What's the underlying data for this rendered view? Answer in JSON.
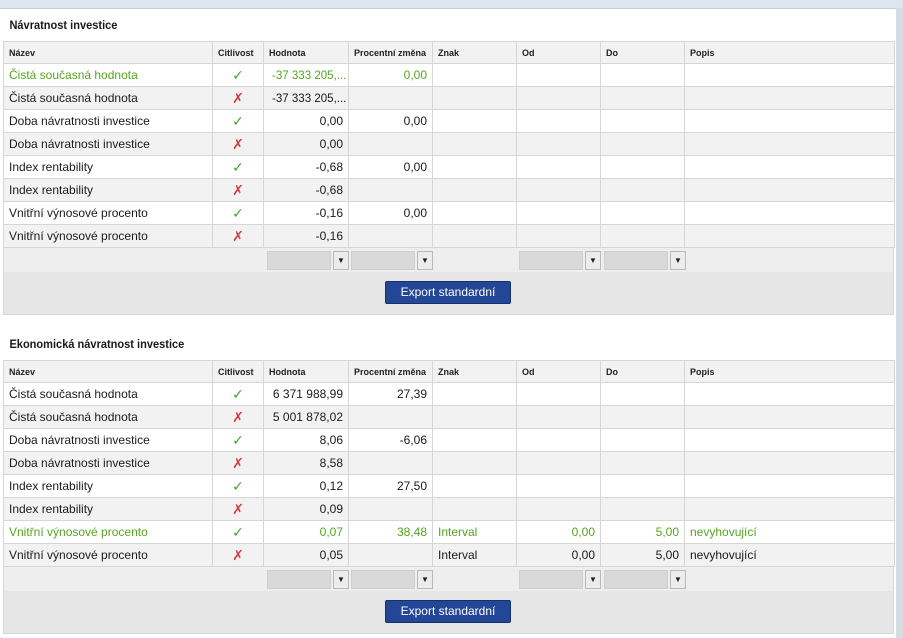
{
  "sections": [
    {
      "title": "Návratnost investice",
      "columns": [
        "Název",
        "Citlivost",
        "Hodnota",
        "Procentní změna",
        "Znak",
        "Od",
        "Do",
        "Popis"
      ],
      "rows": [
        {
          "name": "Čistá současná hodnota",
          "sensitivity": "✓",
          "value": "-37 333 205,...",
          "change": "0,00",
          "sign": "",
          "from": "",
          "to": "",
          "desc": "",
          "highlight": true
        },
        {
          "name": "Čistá současná hodnota",
          "sensitivity": "✗",
          "value": "-37 333 205,...",
          "change": "",
          "sign": "",
          "from": "",
          "to": "",
          "desc": "",
          "highlight": false
        },
        {
          "name": "Doba návratnosti investice",
          "sensitivity": "✓",
          "value": "0,00",
          "change": "0,00",
          "sign": "",
          "from": "",
          "to": "",
          "desc": "",
          "highlight": false
        },
        {
          "name": "Doba návratnosti investice",
          "sensitivity": "✗",
          "value": "0,00",
          "change": "",
          "sign": "",
          "from": "",
          "to": "",
          "desc": "",
          "highlight": false
        },
        {
          "name": "Index rentability",
          "sensitivity": "✓",
          "value": "-0,68",
          "change": "0,00",
          "sign": "",
          "from": "",
          "to": "",
          "desc": "",
          "highlight": false
        },
        {
          "name": "Index rentability",
          "sensitivity": "✗",
          "value": "-0,68",
          "change": "",
          "sign": "",
          "from": "",
          "to": "",
          "desc": "",
          "highlight": false
        },
        {
          "name": "Vnitřní výnosové procento",
          "sensitivity": "✓",
          "value": "-0,16",
          "change": "0,00",
          "sign": "",
          "from": "",
          "to": "",
          "desc": "",
          "highlight": false
        },
        {
          "name": "Vnitřní výnosové procento",
          "sensitivity": "✗",
          "value": "-0,16",
          "change": "",
          "sign": "",
          "from": "",
          "to": "",
          "desc": "",
          "highlight": false
        }
      ],
      "export_label": "Export standardní"
    },
    {
      "title": "Ekonomická návratnost investice",
      "columns": [
        "Název",
        "Citlivost",
        "Hodnota",
        "Procentní změna",
        "Znak",
        "Od",
        "Do",
        "Popis"
      ],
      "rows": [
        {
          "name": "Čistá současná hodnota",
          "sensitivity": "✓",
          "value": "6 371 988,99",
          "change": "27,39",
          "sign": "",
          "from": "",
          "to": "",
          "desc": "",
          "highlight": false
        },
        {
          "name": "Čistá současná hodnota",
          "sensitivity": "✗",
          "value": "5 001 878,02",
          "change": "",
          "sign": "",
          "from": "",
          "to": "",
          "desc": "",
          "highlight": false
        },
        {
          "name": "Doba návratnosti investice",
          "sensitivity": "✓",
          "value": "8,06",
          "change": "-6,06",
          "sign": "",
          "from": "",
          "to": "",
          "desc": "",
          "highlight": false
        },
        {
          "name": "Doba návratnosti investice",
          "sensitivity": "✗",
          "value": "8,58",
          "change": "",
          "sign": "",
          "from": "",
          "to": "",
          "desc": "",
          "highlight": false
        },
        {
          "name": "Index rentability",
          "sensitivity": "✓",
          "value": "0,12",
          "change": "27,50",
          "sign": "",
          "from": "",
          "to": "",
          "desc": "",
          "highlight": false
        },
        {
          "name": "Index rentability",
          "sensitivity": "✗",
          "value": "0,09",
          "change": "",
          "sign": "",
          "from": "",
          "to": "",
          "desc": "",
          "highlight": false
        },
        {
          "name": "Vnitřní výnosové procento",
          "sensitivity": "✓",
          "value": "0,07",
          "change": "38,48",
          "sign": "Interval",
          "from": "0,00",
          "to": "5,00",
          "desc": "nevyhovující",
          "highlight": true
        },
        {
          "name": "Vnitřní výnosové procento",
          "sensitivity": "✗",
          "value": "0,05",
          "change": "",
          "sign": "Interval",
          "from": "0,00",
          "to": "5,00",
          "desc": "nevyhovující",
          "highlight": false
        }
      ],
      "export_label": "Export standardní"
    }
  ],
  "icons": {
    "ok": "check-icon",
    "bad": "cross-icon",
    "dropdown": "chevron-down-icon"
  },
  "filter_arrow": "▼",
  "colors": {
    "ok": "#3fa62a",
    "bad": "#d63b3b",
    "highlight_text": "#55a51f",
    "button": "#234796"
  }
}
